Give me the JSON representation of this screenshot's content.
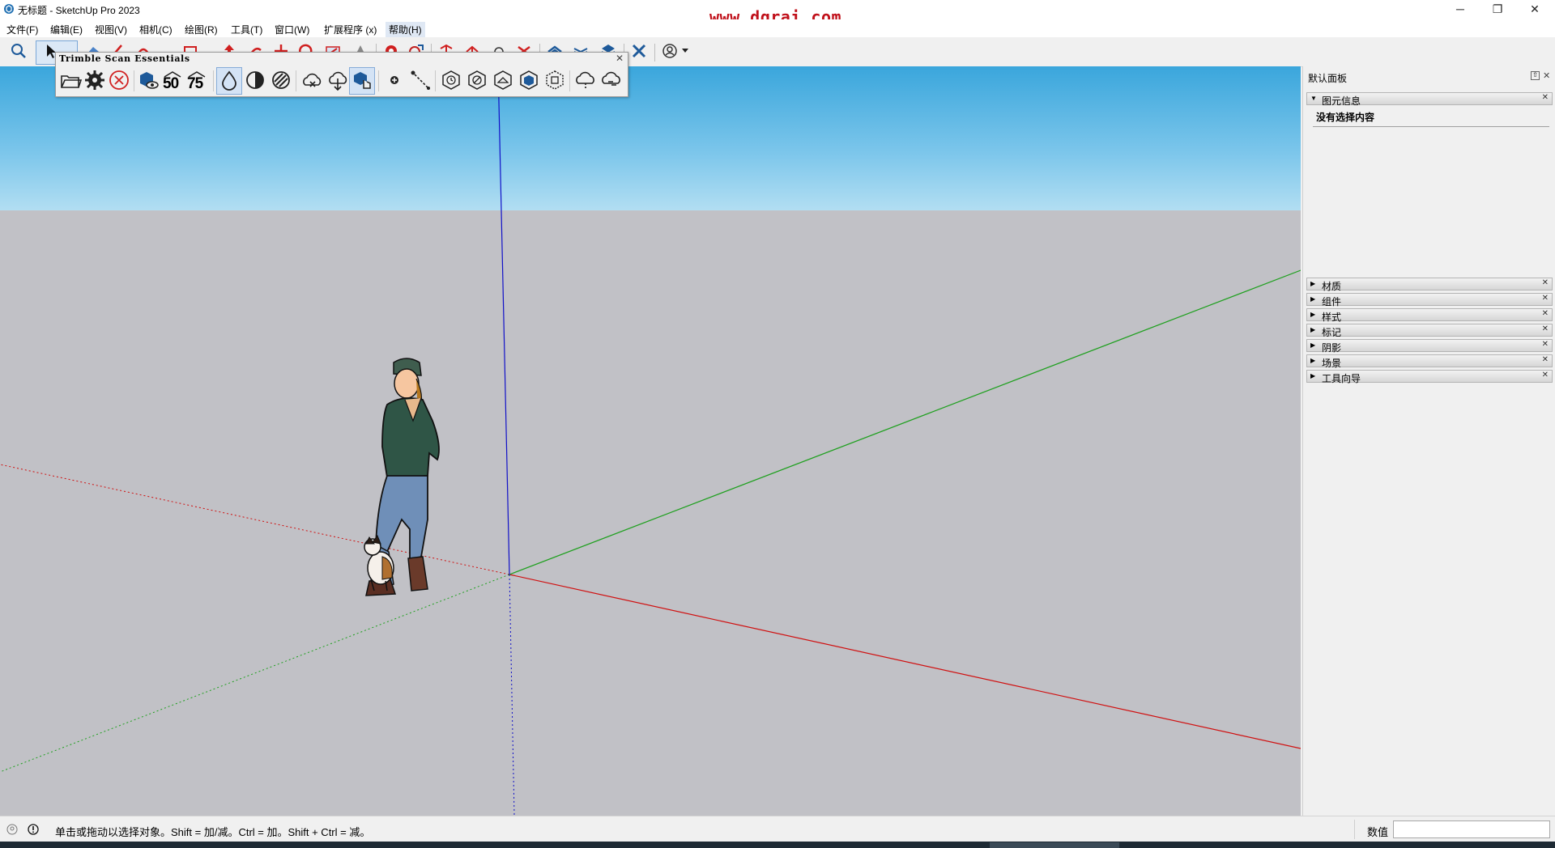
{
  "window": {
    "title": "无标题 - SketchUp Pro 2023",
    "watermark": "www.dgrai.com",
    "minimize_icon": "minimize-icon",
    "restore_icon": "restore-icon",
    "close_icon": "close-icon"
  },
  "menu": {
    "items": [
      "文件(F)",
      "编辑(E)",
      "视图(V)",
      "相机(C)",
      "绘图(R)",
      "工具(T)",
      "窗口(W)",
      "扩展程序 (x)",
      "帮助(H)"
    ],
    "active_index": 8
  },
  "toolbar": {
    "icons": [
      "search-icon",
      "select-icon",
      "eraser-icon",
      "line-icon",
      "arc-icon",
      "rectangle-icon",
      "pushpull-icon",
      "move-icon",
      "rotate-icon",
      "scale-icon",
      "offset-icon",
      "paint-icon",
      "tape-icon",
      "section-icon",
      "section-fill-icon",
      "orbit-icon",
      "pan-icon",
      "layer-icon",
      "layer2-icon",
      "layer3-icon",
      "scan-tool-icon",
      "account-icon"
    ]
  },
  "scan_palette": {
    "title": "Trimble Scan Essentials",
    "buttons": [
      {
        "name": "open-folder-icon",
        "label": ""
      },
      {
        "name": "settings-gear-icon",
        "label": ""
      },
      {
        "name": "cancel-circle-icon",
        "label": ""
      },
      {
        "name": "scan-view-icon",
        "label": ""
      },
      {
        "name": "scan-50-icon",
        "label": "50"
      },
      {
        "name": "scan-75-icon",
        "label": "75"
      },
      {
        "name": "drop-outline-icon",
        "label": ""
      },
      {
        "name": "contrast-icon",
        "label": ""
      },
      {
        "name": "hatched-circle-icon",
        "label": ""
      },
      {
        "name": "cloud-x-icon",
        "label": ""
      },
      {
        "name": "cloud-download-icon",
        "label": ""
      },
      {
        "name": "scan-hand-icon",
        "label": ""
      },
      {
        "name": "add-point-icon",
        "label": ""
      },
      {
        "name": "dashed-line-icon",
        "label": ""
      },
      {
        "name": "hex-clock-icon",
        "label": ""
      },
      {
        "name": "hex-slash-icon",
        "label": ""
      },
      {
        "name": "hex-home-icon",
        "label": ""
      },
      {
        "name": "hex-cube-icon",
        "label": ""
      },
      {
        "name": "hex-box-icon",
        "label": ""
      },
      {
        "name": "cloud-dots-icon",
        "label": ""
      },
      {
        "name": "cloud-sync-icon",
        "label": ""
      }
    ]
  },
  "right_panel": {
    "title": "默认面板",
    "entity_info": {
      "label": "图元信息",
      "body_text": "没有选择内容"
    },
    "trays": [
      "材质",
      "组件",
      "样式",
      "标记",
      "阴影",
      "场景",
      "工具向导"
    ]
  },
  "statusbar": {
    "hint": "单击或拖动以选择对象。Shift = 加/减。Ctrl = 加。Shift + Ctrl = 减。",
    "measurements_label": "数值",
    "measurements_value": ""
  },
  "colors": {
    "axis_red": "#d01010",
    "axis_green": "#1fa01f",
    "axis_blue": "#1010c8",
    "sky_top": "#3aa6dc",
    "ground": "#c1c1c6",
    "watermark": "#c0101a"
  }
}
